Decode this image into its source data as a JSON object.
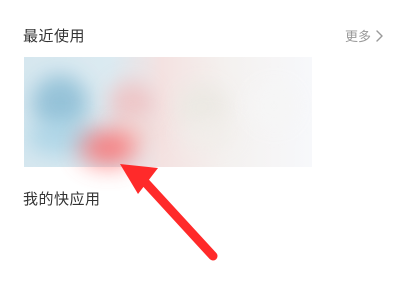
{
  "recent": {
    "title": "最近使用",
    "more_label": "更多",
    "more_icon": "chevron-right-icon",
    "items": [
      {
        "name": "blurred-app-1",
        "accent": "#8fbfd6"
      },
      {
        "name": "blurred-app-2",
        "accent": "#f0bfc0"
      },
      {
        "name": "blurred-app-3",
        "accent": "#ebe9e3"
      },
      {
        "name": "blurred-app-4",
        "accent": "#f6f6f6"
      }
    ]
  },
  "my_quick_apps": {
    "title": "我的快应用"
  },
  "colors": {
    "title_text": "#333333",
    "muted_text": "#999999",
    "arrow": "#ff2a2a"
  }
}
